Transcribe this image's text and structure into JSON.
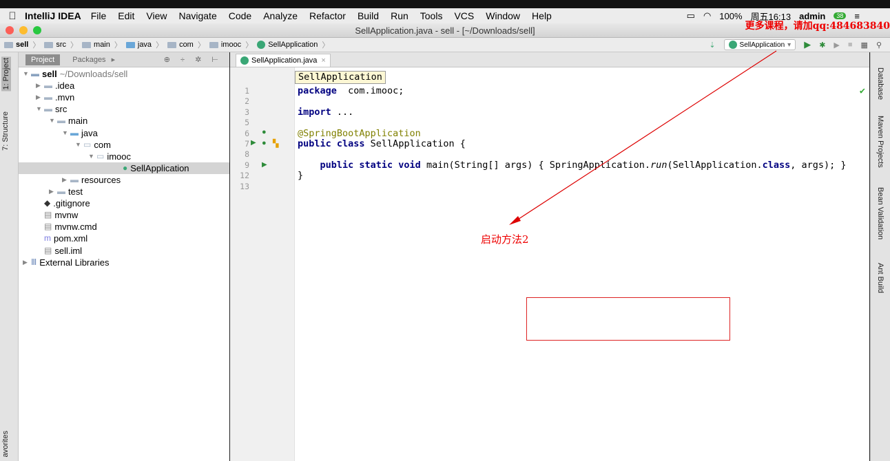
{
  "menubar": {
    "app": "IntelliJ IDEA",
    "items": [
      "File",
      "Edit",
      "View",
      "Navigate",
      "Code",
      "Analyze",
      "Refactor",
      "Build",
      "Run",
      "Tools",
      "VCS",
      "Window",
      "Help"
    ],
    "battery": "100%",
    "clock": "周五16:13",
    "user": "admin",
    "badge": "38"
  },
  "window": {
    "title": "SellApplication.java - sell - [~/Downloads/sell]",
    "promo": "更多课程，请加qq:484683840"
  },
  "breadcrumbs": [
    "sell",
    "src",
    "main",
    "java",
    "com",
    "imooc",
    "SellApplication"
  ],
  "run_config": "SellApplication",
  "left_tabs": {
    "project": "1: Project",
    "structure": "7: Structure",
    "favorites": "avorites"
  },
  "project_panel": {
    "tab_project": "Project",
    "tab_packages": "Packages"
  },
  "tree": [
    {
      "label": "sell",
      "extra": "~/Downloads/sell",
      "indent": 0,
      "arrow": "▼",
      "icon": "folder-module"
    },
    {
      "label": ".idea",
      "indent": 1,
      "arrow": "▶",
      "icon": "folder"
    },
    {
      "label": ".mvn",
      "indent": 1,
      "arrow": "▶",
      "icon": "folder"
    },
    {
      "label": "src",
      "indent": 1,
      "arrow": "▼",
      "icon": "folder"
    },
    {
      "label": "main",
      "indent": 2,
      "arrow": "▼",
      "icon": "folder"
    },
    {
      "label": "java",
      "indent": 3,
      "arrow": "▼",
      "icon": "folder-source"
    },
    {
      "label": "com",
      "indent": 4,
      "arrow": "▼",
      "icon": "package"
    },
    {
      "label": "imooc",
      "indent": 5,
      "arrow": "▼",
      "icon": "package"
    },
    {
      "label": "SellApplication",
      "indent": 7,
      "arrow": "",
      "icon": "spring-class"
    },
    {
      "label": "resources",
      "indent": 3,
      "arrow": "▶",
      "icon": "folder-resources"
    },
    {
      "label": "test",
      "indent": 2,
      "arrow": "▶",
      "icon": "folder"
    },
    {
      "label": ".gitignore",
      "indent": 1,
      "arrow": "",
      "icon": "gitignore"
    },
    {
      "label": "mvnw",
      "indent": 1,
      "arrow": "",
      "icon": "file"
    },
    {
      "label": "mvnw.cmd",
      "indent": 1,
      "arrow": "",
      "icon": "file"
    },
    {
      "label": "pom.xml",
      "indent": 1,
      "arrow": "",
      "icon": "maven"
    },
    {
      "label": "sell.iml",
      "indent": 1,
      "arrow": "",
      "icon": "iml"
    },
    {
      "label": "External Libraries",
      "indent": 0,
      "arrow": "▶",
      "icon": "libraries"
    }
  ],
  "editor": {
    "tab": "SellApplication.java",
    "hint": "SellApplication",
    "line_numbers": [
      "1",
      "2",
      "3",
      "5",
      "6",
      "7",
      "8",
      "9",
      "12",
      "13"
    ],
    "lines": [
      {
        "n": "1",
        "parts": [
          [
            "kw",
            "package"
          ],
          [
            "",
            "  com.imooc;"
          ]
        ]
      },
      {
        "n": "2",
        "parts": []
      },
      {
        "n": "3",
        "parts": [
          [
            "kw",
            "import"
          ],
          [
            "",
            " ..."
          ]
        ]
      },
      {
        "n": "5",
        "parts": []
      },
      {
        "n": "6",
        "parts": [
          [
            "ann",
            "@SpringBootApplication"
          ]
        ]
      },
      {
        "n": "7",
        "parts": [
          [
            "kw",
            "public class"
          ],
          [
            "",
            " SellApplication {"
          ]
        ]
      },
      {
        "n": "8",
        "parts": []
      },
      {
        "n": "9",
        "parts": [
          [
            "",
            "    "
          ],
          [
            "kw",
            "public static void"
          ],
          [
            "",
            " main(String[] args) { SpringApplication."
          ],
          [
            "it",
            "run"
          ],
          [
            "",
            "(SellApplication."
          ],
          [
            "kw",
            "class"
          ],
          [
            "",
            ", args); }"
          ]
        ]
      },
      {
        "n": "12",
        "parts": [
          [
            "",
            "}"
          ]
        ]
      },
      {
        "n": "13",
        "parts": []
      }
    ]
  },
  "right_tabs": [
    "Database",
    "Maven Projects",
    "Bean Validation",
    "Ant Build"
  ],
  "annotation": {
    "text": "启动方法2"
  }
}
